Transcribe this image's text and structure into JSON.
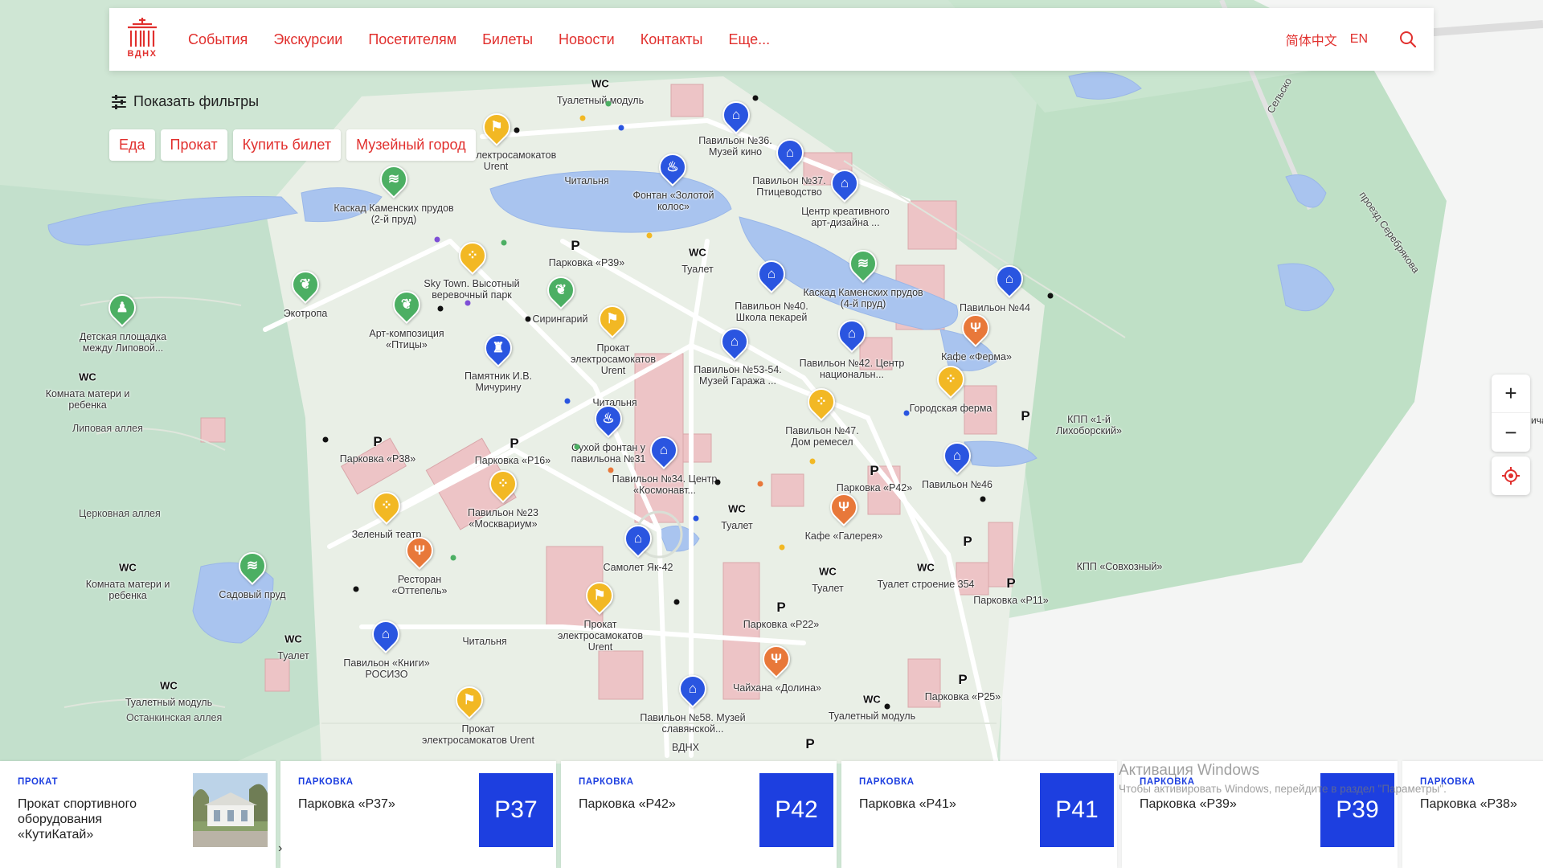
{
  "header": {
    "logo_text": "ВДНХ",
    "nav": [
      "События",
      "Экскурсии",
      "Посетителям",
      "Билеты",
      "Новости",
      "Контакты",
      "Еще..."
    ],
    "lang_zh": "简体中文",
    "lang_en": "EN"
  },
  "filters": {
    "toggle_label": "Показать фильтры",
    "chips": [
      "Еда",
      "Прокат",
      "Купить билет",
      "Музейный город"
    ]
  },
  "zoom": {
    "in": "+",
    "out": "−"
  },
  "edge_label": "ича",
  "map": {
    "streets": [
      "Сельско",
      "проезд Серебрякова",
      "Липовая аллея",
      "Церковная аллея",
      "Останкинская аллея"
    ],
    "labels": [
      "Туалетный модуль",
      "Павильон №36. Музей кино",
      "Прокат электросамокатов Urent",
      "Читальня",
      "Фонтан «Золотой колос»",
      "Павильон №37. Птицеводство",
      "Центр креативного арт-дизайна ...",
      "Каскад Каменских прудов (2-й пруд)",
      "Парковка «Р39»",
      "Туалет",
      "Sky Town. Высотный веревочный парк",
      "Экотропа",
      "Сирингарий",
      "Каскад Каменских прудов (4-й пруд)",
      "Павильон №44",
      "Павильон №40. Школа пекарей",
      "Детская площадка между Липовой...",
      "Арт-композиция «Птицы»",
      "Прокат электросамокатов Urent",
      "Кафе «Ферма»",
      "Павильон №42. Центр национальн...",
      "Памятник И.В. Мичурину",
      "Павильон №53-54. Музей Гаража ...",
      "Комната матери и ребенка",
      "Читальня",
      "Городская ферма",
      "Павильон №47. Дом ремесел",
      "КПП «1-й Лихоборский»",
      "Парковка «Р38»",
      "Парковка «Р16»",
      "Сухой фонтан у павильона №31",
      "Павильон №34. Центр «Космонавт...",
      "Павильон №46",
      "Парковка «Р42»",
      "Павильон №23 «Москвариум»",
      "Зеленый театр",
      "Туалет",
      "Кафе «Галерея»",
      "Самолет Як-42",
      "Комната матери и ребенка",
      "Ресторан «Оттепель»",
      "Садовый пруд",
      "Туалет",
      "Туалет строение 354",
      "КПП «Совхозный»",
      "Парковка «Р11»",
      "Прокат электросамокатов Urent",
      "Парковка «Р22»",
      "Павильон «Книги» РОСИЗО",
      "Читальня",
      "Туалет",
      "Чайхана «Долина»",
      "Парковка «Р25»",
      "Туалетный модуль",
      "Туалетный модуль",
      "Павильон №58. Музей славянской...",
      "Прокат электросамокатов Urent",
      "ВДНХ"
    ]
  },
  "cards": [
    {
      "category": "ПРОКАТ",
      "title": "Прокат спортивного оборудования «КутиКатай»",
      "badge": ""
    },
    {
      "category": "ПАРКОВКА",
      "title": "Парковка «Р37»",
      "badge": "P37"
    },
    {
      "category": "ПАРКОВКА",
      "title": "Парковка «Р42»",
      "badge": "P42"
    },
    {
      "category": "ПАРКОВКА",
      "title": "Парковка «Р41»",
      "badge": "P41"
    },
    {
      "category": "ПАРКОВКА",
      "title": "Парковка «Р39»",
      "badge": "P39"
    },
    {
      "category": "ПАРКОВКА",
      "title": "Парковка «Р38»",
      "badge": ""
    }
  ],
  "watermark": {
    "title": "Активация Windows",
    "subtitle": "Чтобы активировать Windows, перейдите в раздел \"Параметры\"."
  },
  "colors": {
    "brand_red": "#e1302e",
    "parking_blue": "#1d3fe0",
    "museum_pin": "#2a55e0",
    "food_pin": "#e8783a",
    "rental_pin": "#f2b824",
    "nature_pin": "#4caf63"
  }
}
